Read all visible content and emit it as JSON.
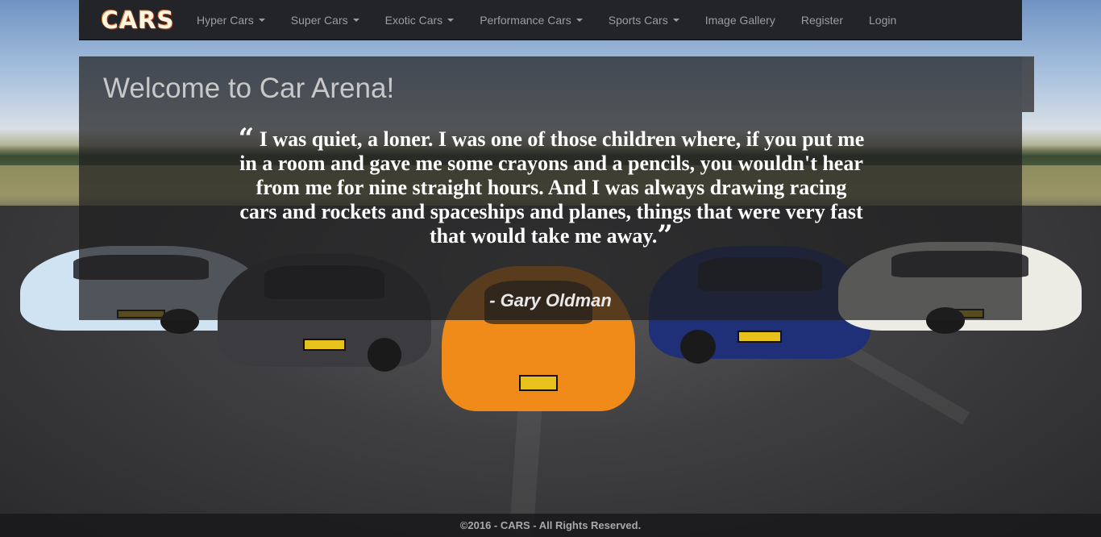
{
  "brand": {
    "logo_text": "CARS"
  },
  "nav": {
    "items": [
      {
        "label": "Hyper Cars",
        "dropdown": true
      },
      {
        "label": "Super Cars",
        "dropdown": true
      },
      {
        "label": "Exotic Cars",
        "dropdown": true
      },
      {
        "label": "Performance Cars",
        "dropdown": true
      },
      {
        "label": "Sports Cars",
        "dropdown": true
      },
      {
        "label": "Image Gallery",
        "dropdown": false
      },
      {
        "label": "Register",
        "dropdown": false
      },
      {
        "label": "Login",
        "dropdown": false
      }
    ]
  },
  "welcome": {
    "title": "Welcome to Car Arena!",
    "quote": "I was quiet, a loner. I was one of those children where, if you put me in a room and gave me some crayons and a pencils, you wouldn't hear from me for nine straight hours. And I was always drawing racing cars and rockets and spaceships and planes, things that were very fast that would take me away.",
    "author": "- Gary Oldman"
  },
  "footer": {
    "text": "©2016 - CARS - All Rights Reserved."
  },
  "colors": {
    "navbar_bg": "#222428",
    "nav_text": "#9d9d9d",
    "panel_bg": "rgba(30,30,32,0.72)",
    "quote_text": "#ffffff"
  }
}
